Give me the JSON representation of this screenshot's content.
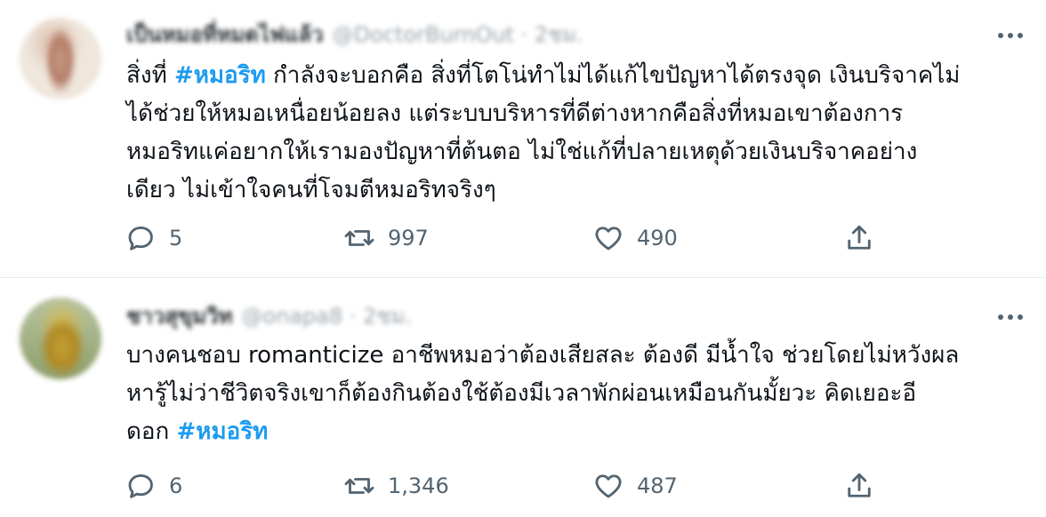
{
  "tweets": [
    {
      "author_name_blurred": "เป็นหมอที่หมดไฟแล้ว",
      "handle_blurred": "@DoctorBurnOut · 2ชม.",
      "text_before_tag": "สิ่งที่ ",
      "hashtag": "#หมอริท",
      "lines": [
        " กำลังจะบอกคือ สิ่งที่โตโน่ทำไม่ได้แก้ไขปัญหาได้ตรงจุด เงินบริจาคไม่",
        "ได้ช่วยให้หมอเหนื่อยน้อยลง แต่ระบบบริหารที่ดีต่างหากคือสิ่งที่หมอเขาต้องการ",
        "หมอริทแค่อยากให้เรามองปัญหาที่ต้นตอ ไม่ใช่แก้ที่ปลายเหตุด้วยเงินบริจาคอย่าง",
        "เดียว ไม่เข้าใจคนที่โจมตีหมอริทจริงๆ"
      ],
      "reply_count": "5",
      "retweet_count": "997",
      "like_count": "490"
    },
    {
      "author_name_blurred": "ชาวสุขุมวิท",
      "handle_blurred": "@onapa8 · 2ชม.",
      "lines": [
        "บางคนชอบ romanticize อาชีพหมอว่าต้องเสียสละ ต้องดี มีน้ำใจ ช่วยโดยไม่หวังผล",
        "หารู้ไม่ว่าชีวิตจริงเขาก็ต้องกินต้องใช้ต้องมีเวลาพักผ่อนเหมือนกันมั้ยวะ คิดเยอะอี",
        "ดอก "
      ],
      "hashtag": "#หมอริท",
      "reply_count": "6",
      "retweet_count": "1,346",
      "like_count": "487"
    }
  ],
  "colors": {
    "hashtag": "#1d9bf0",
    "action_gray": "#536471",
    "divider": "#e6ecf0"
  },
  "icons": [
    "more-icon",
    "reply-icon",
    "retweet-icon",
    "like-icon",
    "share-icon"
  ]
}
